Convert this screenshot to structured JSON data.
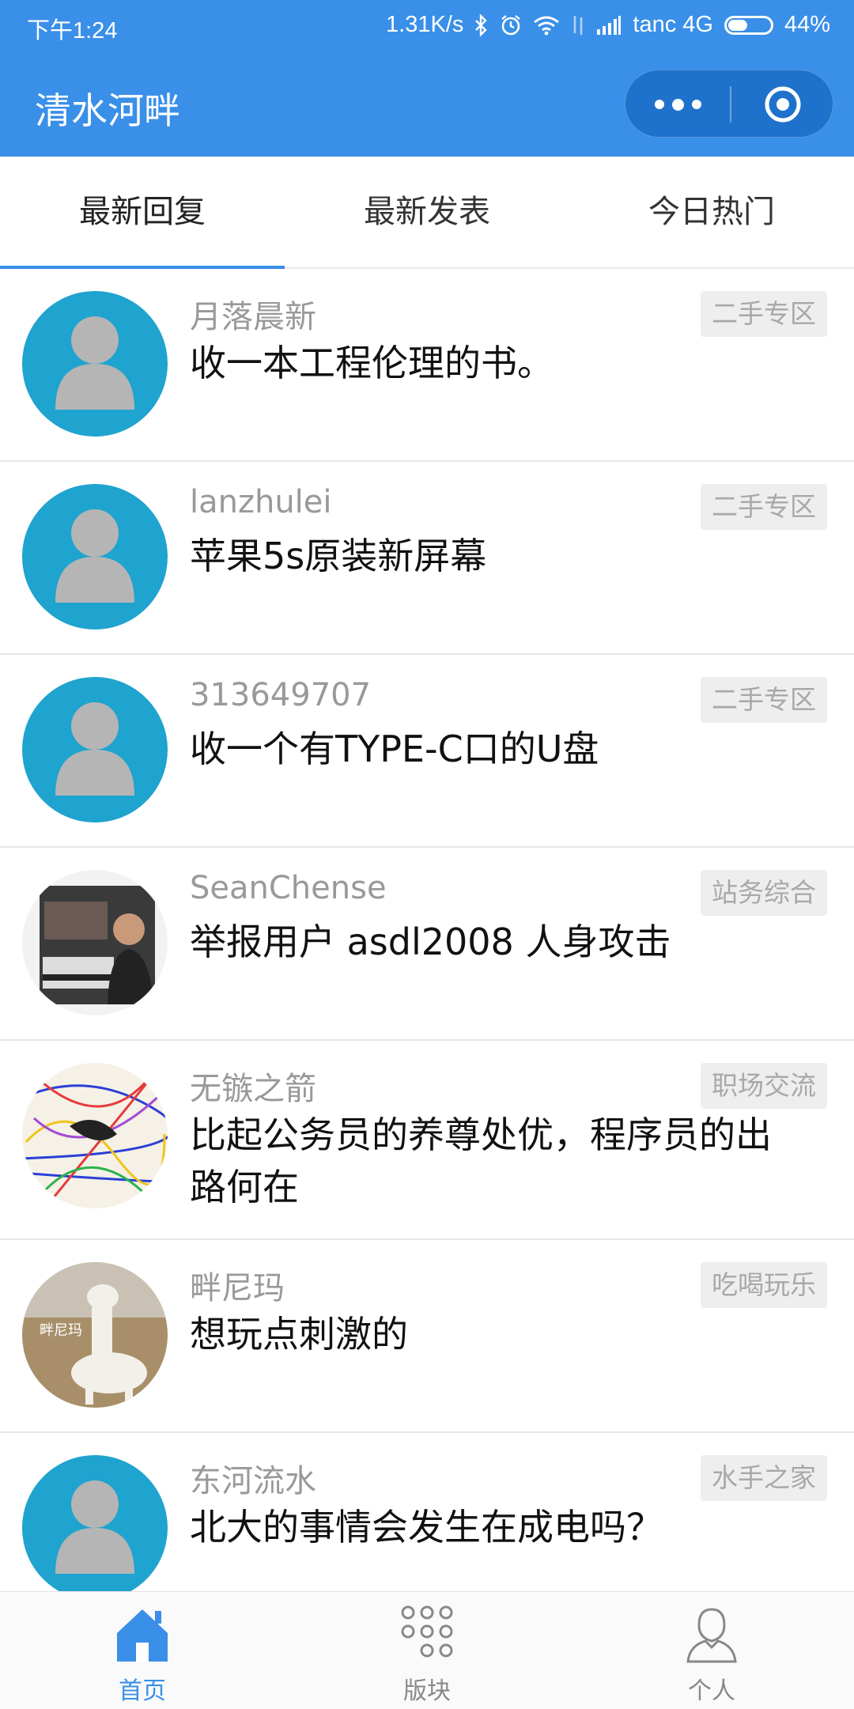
{
  "status_bar": {
    "time": "下午1:24",
    "speed": "1.31K/s",
    "carrier": "tanc 4G",
    "battery": "44%",
    "battery_level": 0.44
  },
  "header": {
    "title": "清水河畔"
  },
  "tabs": [
    {
      "label": "最新回复",
      "active": true
    },
    {
      "label": "最新发表",
      "active": false
    },
    {
      "label": "今日热门",
      "active": false
    }
  ],
  "posts": [
    {
      "author": "月落晨新",
      "board": "二手专区",
      "title": "收一本工程伦理的书。",
      "avatar": "default-avatar"
    },
    {
      "author": "lanzhulei",
      "board": "二手专区",
      "title": "苹果5s原装新屏幕",
      "avatar": "default-avatar"
    },
    {
      "author": "313649707",
      "board": "二手专区",
      "title": "收一个有TYPE-C口的U盘",
      "avatar": "default-avatar"
    },
    {
      "author": "SeanChense",
      "board": "站务综合",
      "title": "举报用户 asdl2008 人身攻击",
      "avatar": "photo-avatar"
    },
    {
      "author": "无镞之箭",
      "board": "职场交流",
      "title": "比起公务员的养尊处优，程序员的出路何在",
      "avatar": "scribble-avatar"
    },
    {
      "author": "畔尼玛",
      "board": "吃喝玩乐",
      "title": "想玩点刺激的",
      "avatar": "alpaca-avatar",
      "avatar_caption": "畔尼玛"
    },
    {
      "author": "东河流水",
      "board": "水手之家",
      "title": "北大的事情会发生在成电吗？",
      "avatar": "default-avatar"
    }
  ],
  "bottom_nav": [
    {
      "label": "首页",
      "icon": "home-icon",
      "active": true
    },
    {
      "label": "版块",
      "icon": "grid-dots-icon",
      "active": false
    },
    {
      "label": "个人",
      "icon": "person-icon",
      "active": false
    }
  ],
  "colors": {
    "brand": "#3a8fe8",
    "avatar_bg": "#1fa3cf"
  }
}
